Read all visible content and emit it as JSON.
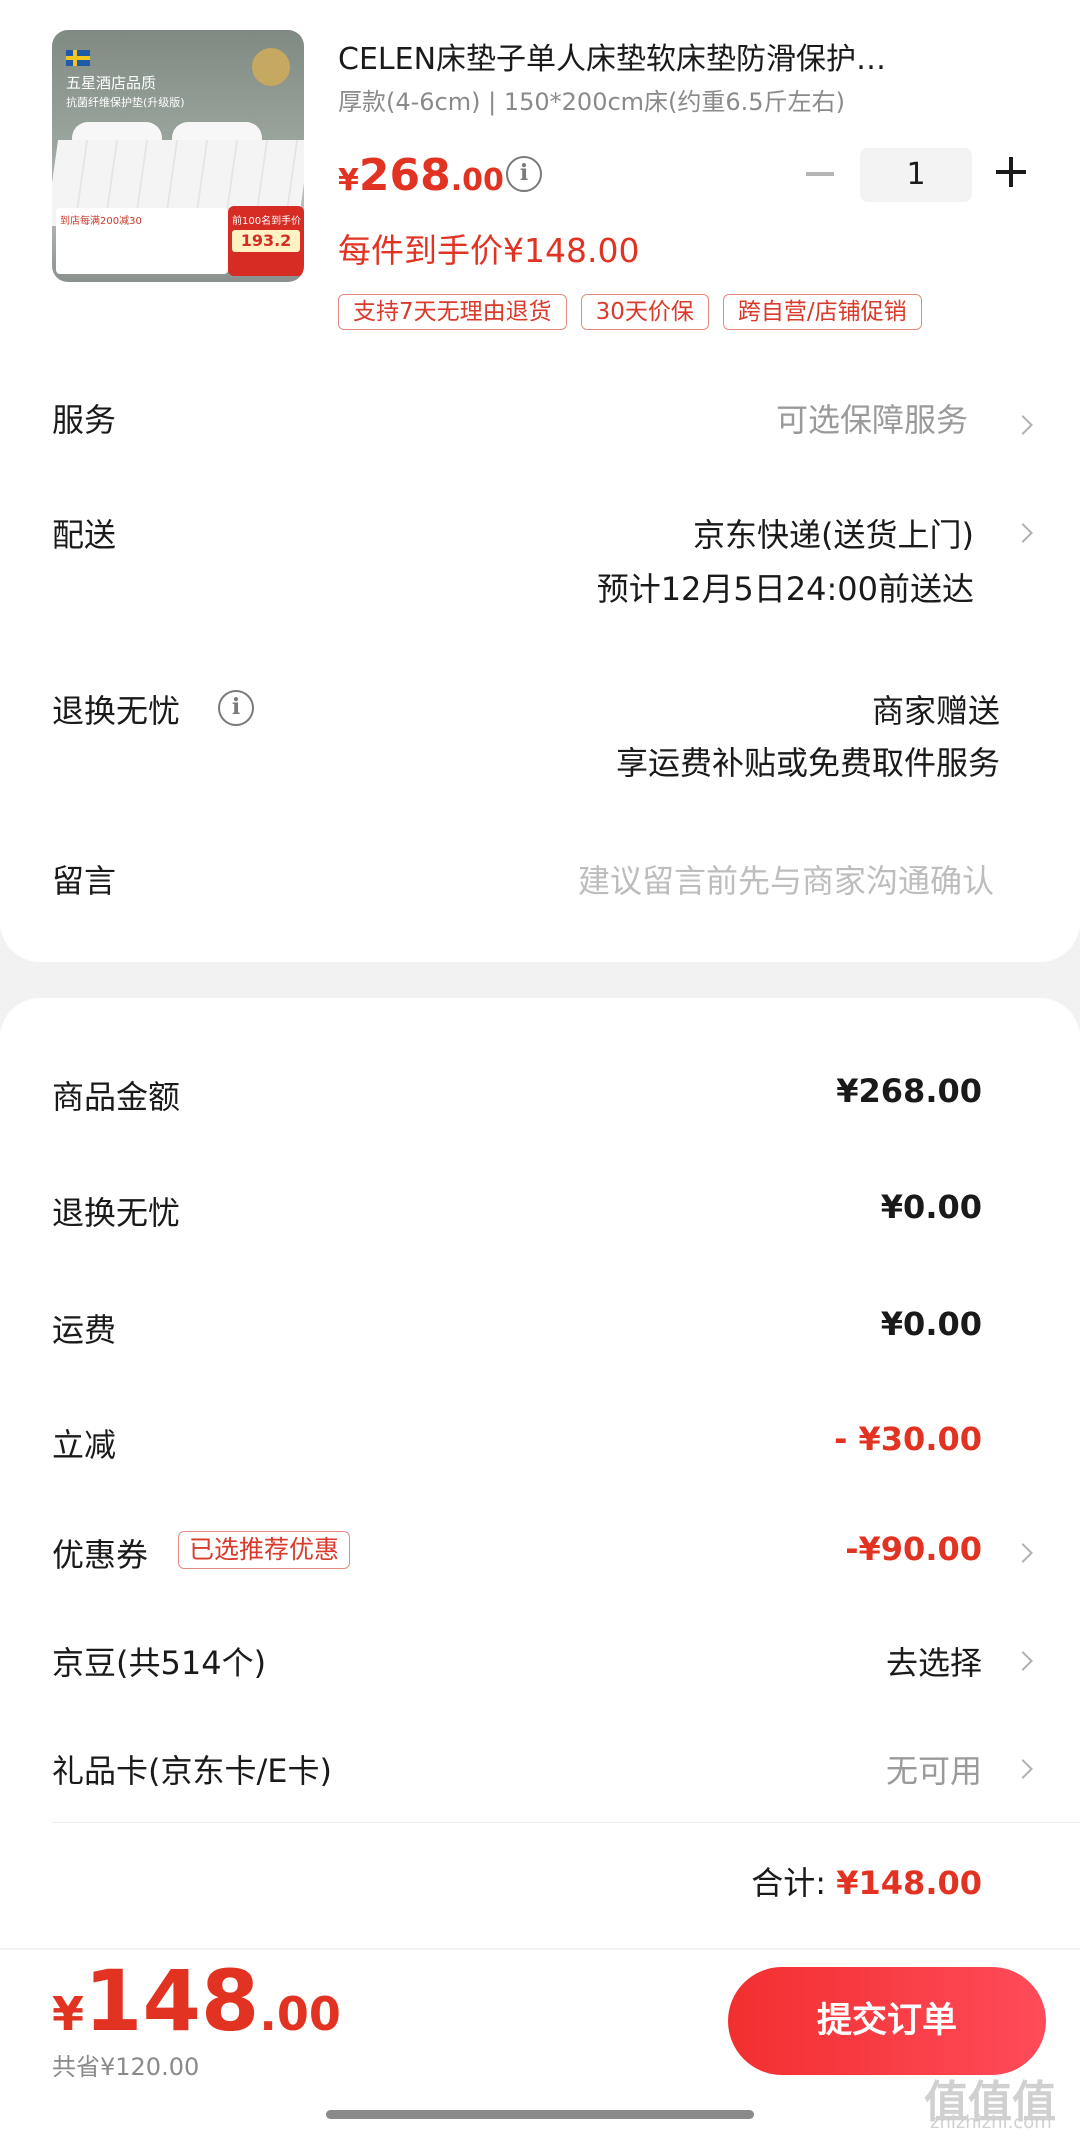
{
  "product": {
    "image_alt": "mattress pad product photo",
    "image_texts": {
      "top_line": "五星酒店品质",
      "second_line": "抗菌纤维保护垫(升级版)",
      "badge_left": "到店每满200减30",
      "badge_red_top": "前100名到手价",
      "badge_red_price": "193.2"
    },
    "title": "CELEN床垫子单人床垫软床垫防滑保护…",
    "spec": "厚款(4-6cm) | 150*200cm床(约重6.5斤左右)",
    "price_currency": "¥",
    "price_int": "268",
    "price_dec": ".00",
    "quantity": "1",
    "final_price": "每件到手价¥148.00",
    "tags": [
      "支持7天无理由退货",
      "30天价保",
      "跨自营/店铺促销"
    ]
  },
  "rows": {
    "service": {
      "label": "服务",
      "value": "可选保障服务"
    },
    "delivery": {
      "label": "配送",
      "value": "京东快递(送货上门)",
      "eta": "预计12月5日24:00前送达"
    },
    "returns": {
      "label": "退换无忧",
      "value": "商家赠送",
      "sub": "享运费补贴或免费取件服务"
    },
    "note": {
      "label": "留言",
      "placeholder": "建议留言前先与商家沟通确认"
    }
  },
  "summary": {
    "goods": {
      "label": "商品金额",
      "value": "¥268.00"
    },
    "returns": {
      "label": "退换无忧",
      "value": "¥0.00"
    },
    "shipping": {
      "label": "运费",
      "value": "¥0.00"
    },
    "discount": {
      "label": "立减",
      "value": "- ¥30.00"
    },
    "coupon": {
      "label": "优惠券",
      "tag": "已选推荐优惠",
      "value": "-¥90.00"
    },
    "jingdou": {
      "label": "京豆(共514个)",
      "value": "去选择"
    },
    "giftcard": {
      "label": "礼品卡(京东卡/E卡)",
      "value": "无可用"
    },
    "total_label": "合计:",
    "total_value": "¥148.00"
  },
  "footer": {
    "currency": "¥",
    "pay_int": "148",
    "pay_dec": ".00",
    "saved": "共省¥120.00",
    "submit_label": "提交订单",
    "watermark": "值值值",
    "watermark_sub": "zhizhizhi.com"
  },
  "colors": {
    "accent": "#e23322",
    "background": "#f2f2f2"
  }
}
